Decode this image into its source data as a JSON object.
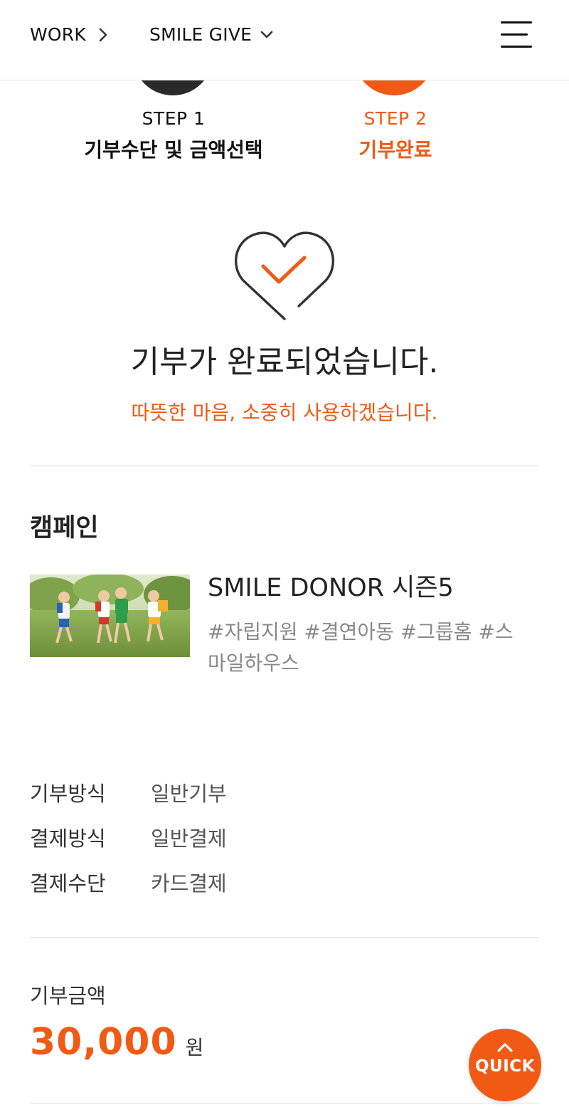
{
  "header": {
    "crumb1": "WORK",
    "crumb2": "SMILE GIVE",
    "menu_icon": "hamburger-menu-icon"
  },
  "steps": [
    {
      "num": "STEP 1",
      "title": "기부수단 및 금액선택",
      "active": false
    },
    {
      "num": "STEP 2",
      "title": "기부완료",
      "active": true
    }
  ],
  "completion": {
    "icon": "heart-check-icon",
    "title": "기부가 완료되었습니다.",
    "subtitle": "따뜻한 마음, 소중히 사용하겠습니다."
  },
  "campaign": {
    "section_title": "캠페인",
    "name": "SMILE DONOR 시즌5",
    "tags": "#자립지원 #결연아동 #그룹홈 #스마일하우스"
  },
  "details": [
    {
      "label": "기부방식",
      "value": "일반기부"
    },
    {
      "label": "결제방식",
      "value": "일반결제"
    },
    {
      "label": "결제수단",
      "value": "카드결제"
    }
  ],
  "amount": {
    "label": "기부금액",
    "value": "30,000",
    "unit": "원"
  },
  "quick": {
    "label": "QUICK",
    "icon": "chevron-up-icon"
  },
  "colors": {
    "accent": "#f05a14",
    "dark": "#2a2a2a"
  }
}
